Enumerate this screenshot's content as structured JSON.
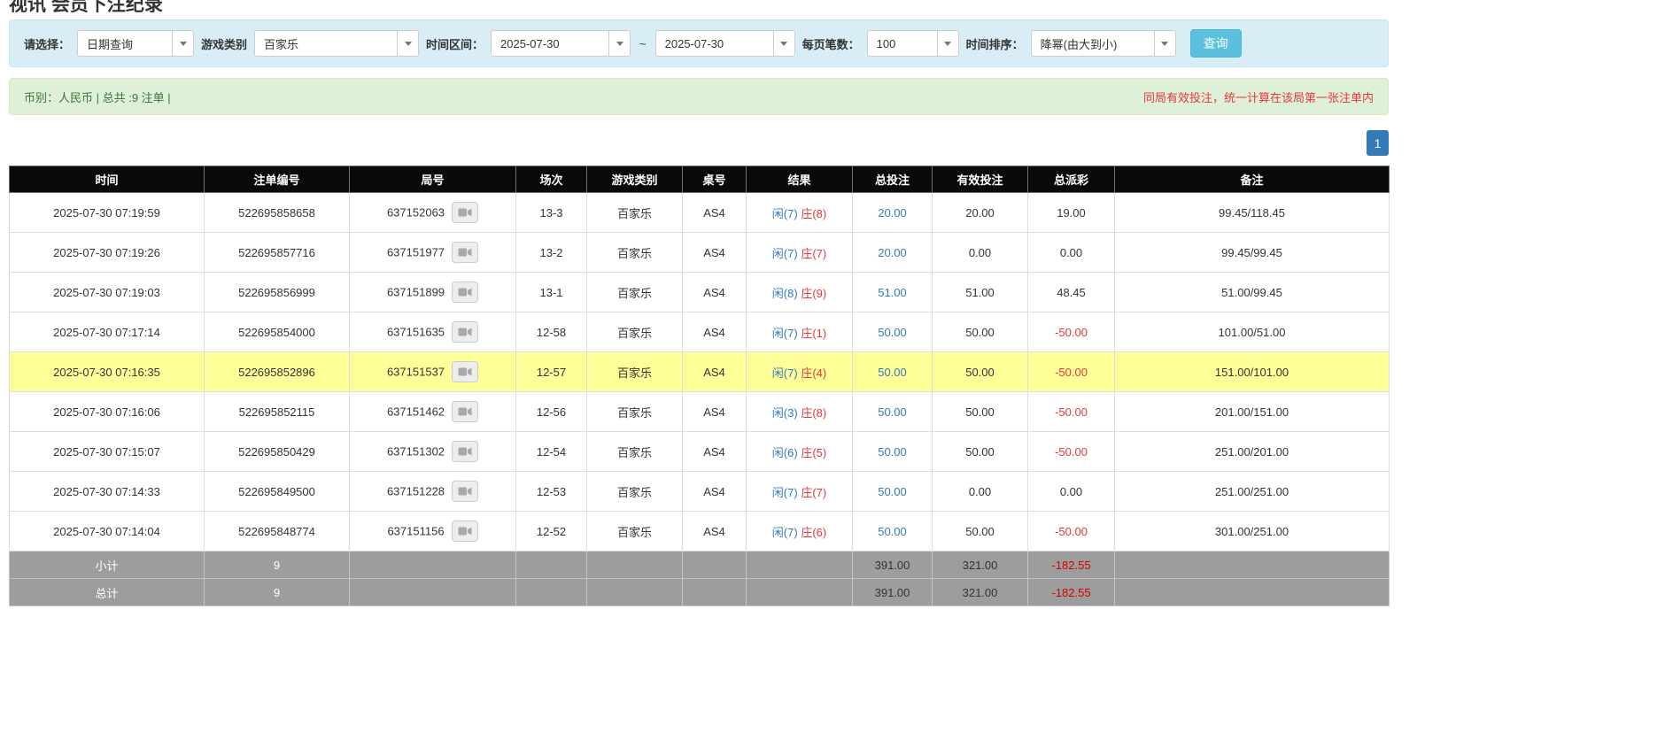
{
  "page_title": "视讯 会员下注纪录",
  "filter": {
    "select_label": "请选择：",
    "select_value": "日期查询",
    "game_type_label": "游戏类别",
    "game_type_value": "百家乐",
    "time_range_label": "时间区间：",
    "date_from": "2025-07-30",
    "range_separator": "~",
    "date_to": "2025-07-30",
    "page_size_label": "每页笔数：",
    "page_size_value": "100",
    "sort_label": "时间排序：",
    "sort_value": "降幂(由大到小)",
    "search_button": "查询"
  },
  "summary": {
    "left": "币别：人民币 | 总共 :9 注单 |",
    "right": "同局有效投注，统一计算在该局第一张注单内"
  },
  "pagination": {
    "current": "1"
  },
  "colors": {
    "player_blue": "#337ab7",
    "banker_red": "#e4393c",
    "negative_red": "#d40000",
    "highlight_yellow": "#ffff99",
    "header_black": "#0a0a0a",
    "footer_gray": "#9d9d9d",
    "filter_bar_blue": "#d9edf7",
    "summary_green": "#dff0d8",
    "search_button_cyan": "#5bc0de"
  },
  "table": {
    "columns": [
      "时间",
      "注单编号",
      "局号",
      "场次",
      "游戏类别",
      "桌号",
      "结果",
      "总投注",
      "有效投注",
      "总派彩",
      "备注"
    ],
    "rows": [
      {
        "time": "2025-07-30 07:19:59",
        "bet_id": "522695858658",
        "round": "637152063",
        "session": "13-3",
        "game": "百家乐",
        "table_no": "AS4",
        "result_player": "闲(7)",
        "result_banker": "庄(8)",
        "total_bet": "20.00",
        "valid_bet": "20.00",
        "payout": "19.00",
        "remark": "99.45/118.45",
        "highlight": false
      },
      {
        "time": "2025-07-30 07:19:26",
        "bet_id": "522695857716",
        "round": "637151977",
        "session": "13-2",
        "game": "百家乐",
        "table_no": "AS4",
        "result_player": "闲(7)",
        "result_banker": "庄(7)",
        "total_bet": "20.00",
        "valid_bet": "0.00",
        "payout": "0.00",
        "remark": "99.45/99.45",
        "highlight": false
      },
      {
        "time": "2025-07-30 07:19:03",
        "bet_id": "522695856999",
        "round": "637151899",
        "session": "13-1",
        "game": "百家乐",
        "table_no": "AS4",
        "result_player": "闲(8)",
        "result_banker": "庄(9)",
        "total_bet": "51.00",
        "valid_bet": "51.00",
        "payout": "48.45",
        "remark": "51.00/99.45",
        "highlight": false
      },
      {
        "time": "2025-07-30 07:17:14",
        "bet_id": "522695854000",
        "round": "637151635",
        "session": "12-58",
        "game": "百家乐",
        "table_no": "AS4",
        "result_player": "闲(7)",
        "result_banker": "庄(1)",
        "total_bet": "50.00",
        "valid_bet": "50.00",
        "payout": "-50.00",
        "remark": "101.00/51.00",
        "highlight": false
      },
      {
        "time": "2025-07-30 07:16:35",
        "bet_id": "522695852896",
        "round": "637151537",
        "session": "12-57",
        "game": "百家乐",
        "table_no": "AS4",
        "result_player": "闲(7)",
        "result_banker": "庄(4)",
        "total_bet": "50.00",
        "valid_bet": "50.00",
        "payout": "-50.00",
        "remark": "151.00/101.00",
        "highlight": true
      },
      {
        "time": "2025-07-30 07:16:06",
        "bet_id": "522695852115",
        "round": "637151462",
        "session": "12-56",
        "game": "百家乐",
        "table_no": "AS4",
        "result_player": "闲(3)",
        "result_banker": "庄(8)",
        "total_bet": "50.00",
        "valid_bet": "50.00",
        "payout": "-50.00",
        "remark": "201.00/151.00",
        "highlight": false
      },
      {
        "time": "2025-07-30 07:15:07",
        "bet_id": "522695850429",
        "round": "637151302",
        "session": "12-54",
        "game": "百家乐",
        "table_no": "AS4",
        "result_player": "闲(6)",
        "result_banker": "庄(5)",
        "total_bet": "50.00",
        "valid_bet": "50.00",
        "payout": "-50.00",
        "remark": "251.00/201.00",
        "highlight": false
      },
      {
        "time": "2025-07-30 07:14:33",
        "bet_id": "522695849500",
        "round": "637151228",
        "session": "12-53",
        "game": "百家乐",
        "table_no": "AS4",
        "result_player": "闲(7)",
        "result_banker": "庄(7)",
        "total_bet": "50.00",
        "valid_bet": "0.00",
        "payout": "0.00",
        "remark": "251.00/251.00",
        "highlight": false
      },
      {
        "time": "2025-07-30 07:14:04",
        "bet_id": "522695848774",
        "round": "637151156",
        "session": "12-52",
        "game": "百家乐",
        "table_no": "AS4",
        "result_player": "闲(7)",
        "result_banker": "庄(6)",
        "total_bet": "50.00",
        "valid_bet": "50.00",
        "payout": "-50.00",
        "remark": "301.00/251.00",
        "highlight": false
      }
    ],
    "footer": [
      {
        "label": "小计",
        "count": "9",
        "total_bet": "391.00",
        "valid_bet": "321.00",
        "payout": "-182.55"
      },
      {
        "label": "总计",
        "count": "9",
        "total_bet": "391.00",
        "valid_bet": "321.00",
        "payout": "-182.55"
      }
    ]
  }
}
